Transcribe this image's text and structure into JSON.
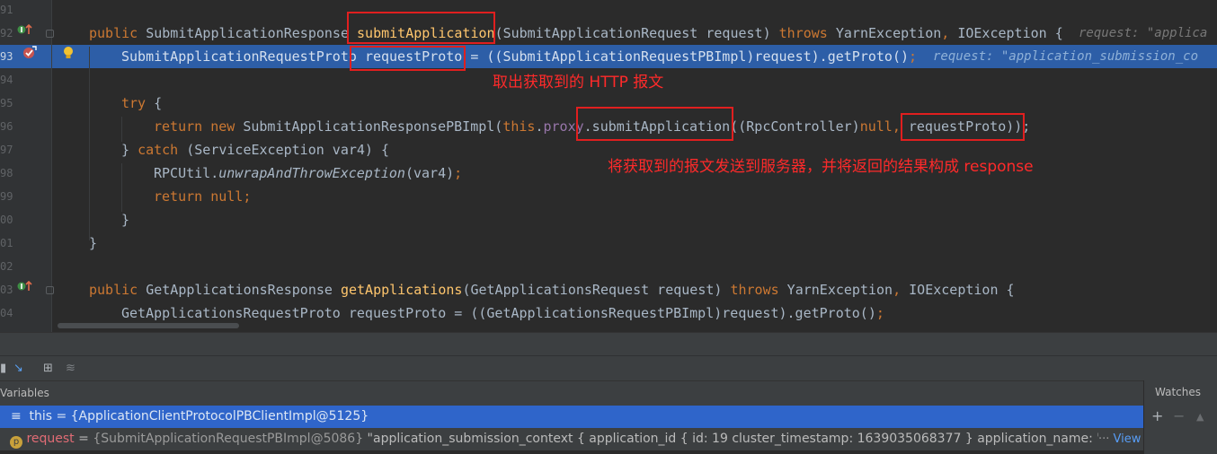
{
  "gutter": {
    "line_numbers": [
      "91",
      "92",
      "93",
      "94",
      "95",
      "96",
      "97",
      "98",
      "99",
      "00",
      "01",
      "02",
      "03",
      "04"
    ]
  },
  "code": {
    "line92": {
      "kw_public": "public",
      "type": "SubmitApplicationResponse",
      "method": "submitApplication",
      "params": "(SubmitApplicationRequest request) ",
      "kw_throws": "throws",
      "exceptions_a": " YarnException",
      "comma": ",",
      "exceptions_b": " IOException {",
      "hint": "request: \"applica"
    },
    "line93": {
      "text_a": "SubmitApplicationRequestProto ",
      "var": "requestProto",
      "text_b": " = ((SubmitApplicationRequestPBImpl)request).getProto()",
      "semi": ";",
      "hint": "request: \"application_submission_co"
    },
    "line95": {
      "kw_try": "try",
      "rest": " {"
    },
    "line96": {
      "kw_return": "return",
      "kw_new": " new",
      "text_a": " SubmitApplicationResponsePBImpl(",
      "kw_this": "this",
      "dot": ".",
      "field": "proxy",
      "text_b": ".submitApplication((RpcController)",
      "kw_null": "null",
      "comma": ",",
      "text_c": " requestProto));"
    },
    "line97": {
      "brace": "} ",
      "kw_catch": "catch",
      "rest": " (ServiceException var4) {"
    },
    "line98": {
      "cls": "RPCUtil.",
      "method": "unwrapAndThrowException",
      "rest": "(var4)",
      "semi": ";"
    },
    "line99": {
      "kw_return": "return",
      "kw_null": " null",
      "semi": ";"
    },
    "line100": {
      "text": "}"
    },
    "line101": {
      "text": "}"
    },
    "line103": {
      "kw_public": "public",
      "type": " GetApplicationsResponse ",
      "method": "getApplications",
      "params": "(GetApplicationsRequest request) ",
      "kw_throws": "throws",
      "exceptions_a": " YarnException",
      "comma": ",",
      "exceptions_b": " IOException {"
    },
    "line104": {
      "text": "GetApplicationsRequestProto requestProto = ((GetApplicationsRequestPBImpl)request).getProto()",
      "semi": ";"
    }
  },
  "annotations": {
    "note1": "取出获取到的 HTTP 报文",
    "note2": "将获取到的报文发送到服务器，并将返回的结果构成 response"
  },
  "debugger": {
    "variables_title": "Variables",
    "watches_title": "Watches",
    "watch_add": "+",
    "watch_remove": "−",
    "watch_up": "▲",
    "rows": [
      {
        "name": "this",
        "eq": " = ",
        "value": "{ApplicationClientProtocolPBClientImpl@5125}"
      },
      {
        "name": "request",
        "eq": " = ",
        "value": "{SubmitApplicationRequestPBImpl@5086}",
        "detail": " \"application_submission_context { application_id { id: 19 cluster_timestamp: 1639035068377 } application_name: \"Flink pe",
        "ellipsis": "··· ",
        "view": "View"
      }
    ]
  },
  "colors": {
    "selection": "#2d5ea7",
    "annotation": "#e01f1f",
    "keyword": "#cc7832",
    "method": "#ffc66d"
  }
}
